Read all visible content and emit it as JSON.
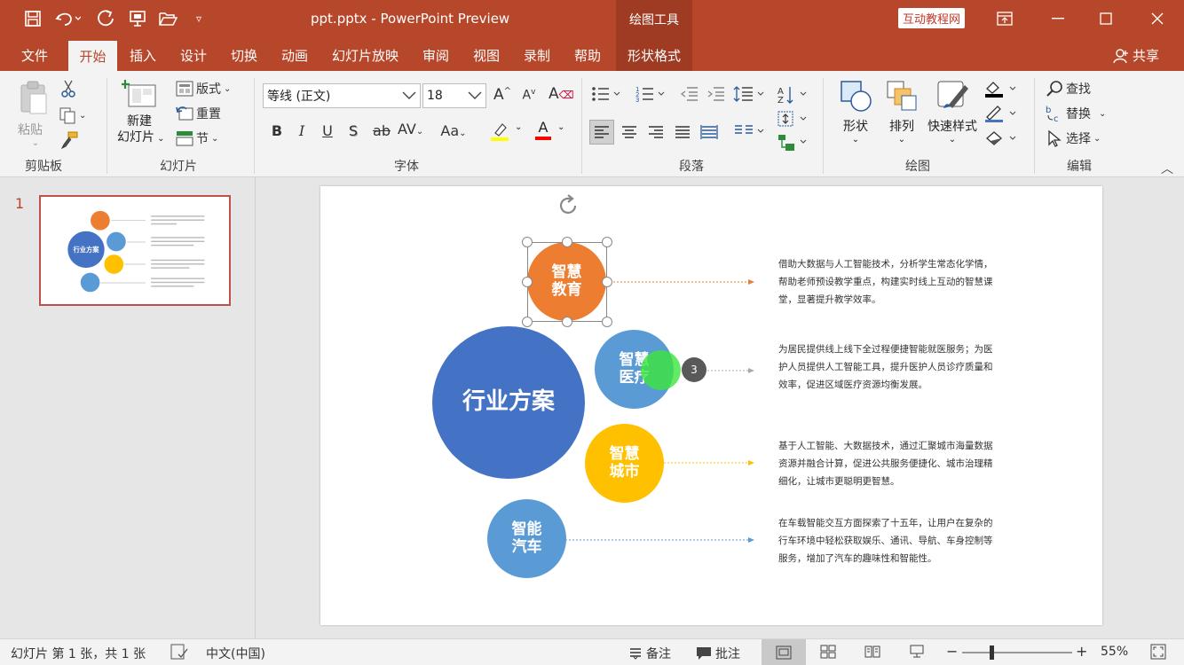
{
  "quick_access": {
    "save_icon": "save-icon",
    "undo_icon": "undo-icon",
    "redo_icon": "redo-icon",
    "present_icon": "present-icon",
    "open_icon": "open-folder-icon",
    "customize_icon": "customize-icon"
  },
  "title": {
    "document": "ppt.pptx  -  PowerPoint Preview",
    "contextual_group": "绘图工具",
    "brand_button": "互动教程网"
  },
  "tabs": [
    {
      "label": "文件"
    },
    {
      "label": "开始"
    },
    {
      "label": "插入"
    },
    {
      "label": "设计"
    },
    {
      "label": "切换"
    },
    {
      "label": "动画"
    },
    {
      "label": "幻灯片放映"
    },
    {
      "label": "审阅"
    },
    {
      "label": "视图"
    },
    {
      "label": "录制"
    },
    {
      "label": "帮助"
    },
    {
      "label": "形状格式"
    }
  ],
  "share_label": "共享",
  "ribbon": {
    "clipboard": {
      "label": "剪贴板",
      "paste": "粘贴"
    },
    "slides": {
      "label": "幻灯片",
      "new_slide_line1": "新建",
      "new_slide_line2": "幻灯片",
      "layout": "版式",
      "reset": "重置",
      "section": "节"
    },
    "font": {
      "label": "字体",
      "font_name": "等线 (正文)",
      "font_size": "18",
      "bold": "B",
      "italic": "I",
      "underline": "U",
      "shadow": "S",
      "strike": "ab",
      "spacing": "AV",
      "case": "Aa",
      "font_color": "A",
      "highlight_color": "#ffff00",
      "font_color_value": "#ff0000"
    },
    "paragraph": {
      "label": "段落"
    },
    "drawing": {
      "label": "绘图",
      "shapes": "形状",
      "arrange": "排列",
      "quick_styles": "快速样式"
    },
    "editing": {
      "label": "编辑",
      "find": "查找",
      "replace": "替换",
      "select": "选择"
    }
  },
  "thumbnail": {
    "number": "1"
  },
  "slide": {
    "center": {
      "text": "行业方案",
      "color": "#4472c4"
    },
    "items": [
      {
        "label_line1": "智慧",
        "label_line2": "教育",
        "color": "#ed7d31",
        "desc": "借助大数据与人工智能技术，分析学生常态化学情，帮助老师预设教学重点，构建实时线上互动的智慧课堂，显著提升教学效率。"
      },
      {
        "label_line1": "智慧",
        "label_line2": "医疗",
        "color": "#5b9bd5",
        "desc": "为居民提供线上线下全过程便捷智能就医服务；为医护人员提供人工智能工具，提升医护人员诊疗质量和效率，促进区域医疗资源均衡发展。"
      },
      {
        "label_line1": "智慧",
        "label_line2": "城市",
        "color": "#ffc000",
        "desc": "基于人工智能、大数据技术，通过汇聚城市海量数据资源并融合计算，促进公共服务便捷化、城市治理精细化，让城市更聪明更智慧。"
      },
      {
        "label_line1": "智能",
        "label_line2": "汽车",
        "color": "#5b9bd5",
        "desc": "在车载智能交互方面探索了十五年，让用户在复杂的行车环境中轻松获取娱乐、通讯、导航、车身控制等服务，增加了汽车的趣味性和智能性。"
      }
    ],
    "animation_badge": "3"
  },
  "status": {
    "slide_info": "幻灯片 第 1 张，共 1 张",
    "language": "中文(中国)",
    "notes": "备注",
    "comments": "批注",
    "zoom": "55%",
    "zoom_fraction": 0.55
  }
}
